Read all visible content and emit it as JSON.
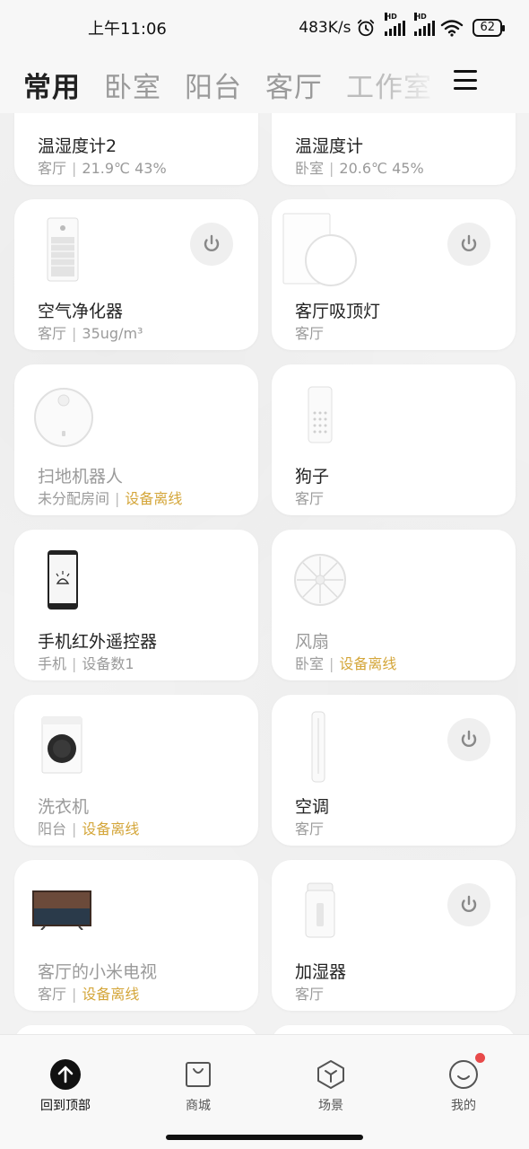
{
  "status_bar": {
    "time": "上午11:06",
    "net_speed": "483K/s",
    "battery": "62",
    "icons": [
      "alarm-icon",
      "signal-hd-icon",
      "signal-hd-icon",
      "wifi-icon",
      "battery-icon"
    ]
  },
  "tabs": [
    {
      "label": "常用",
      "active": true
    },
    {
      "label": "卧室",
      "active": false
    },
    {
      "label": "阳台",
      "active": false
    },
    {
      "label": "客厅",
      "active": false
    },
    {
      "label": "工作室",
      "active": false
    }
  ],
  "menu_icon": "hamburger-menu-icon",
  "devices": [
    {
      "name": "温湿度计2",
      "room": "客厅",
      "detail": "21.9℃ 43%",
      "offline": false
    },
    {
      "name": "温湿度计",
      "room": "卧室",
      "detail": "20.6℃ 45%",
      "offline": false
    },
    {
      "name": "空气净化器",
      "room": "客厅",
      "detail": "35ug/m³",
      "offline": false,
      "power": true
    },
    {
      "name": "客厅吸顶灯",
      "room": "客厅",
      "detail": "",
      "offline": false,
      "power": true
    },
    {
      "name": "扫地机器人",
      "room": "未分配房间",
      "detail": "设备离线",
      "offline": true
    },
    {
      "name": "狗子",
      "room": "客厅",
      "detail": "",
      "offline": false
    },
    {
      "name": "手机红外遥控器",
      "room": "手机",
      "detail": "设备数1",
      "offline": false
    },
    {
      "name": "风扇",
      "room": "卧室",
      "detail": "设备离线",
      "offline": true
    },
    {
      "name": "洗衣机",
      "room": "阳台",
      "detail": "设备离线",
      "offline": true
    },
    {
      "name": "空调",
      "room": "客厅",
      "detail": "",
      "offline": false,
      "power": true
    },
    {
      "name": "客厅的小米电视",
      "room": "客厅",
      "detail": "设备离线",
      "offline": true
    },
    {
      "name": "加湿器",
      "room": "客厅",
      "detail": "",
      "offline": false,
      "power": true
    }
  ],
  "bottom_nav": [
    {
      "label": "回到顶部",
      "icon": "arrow-up-icon",
      "active": true
    },
    {
      "label": "商城",
      "icon": "shopping-bag-icon",
      "active": false
    },
    {
      "label": "场景",
      "icon": "scene-cube-icon",
      "active": false
    },
    {
      "label": "我的",
      "icon": "smile-profile-icon",
      "active": false,
      "badge": true
    }
  ],
  "colors": {
    "offline_text": "#d4a63a",
    "badge": "#e84a4a"
  }
}
